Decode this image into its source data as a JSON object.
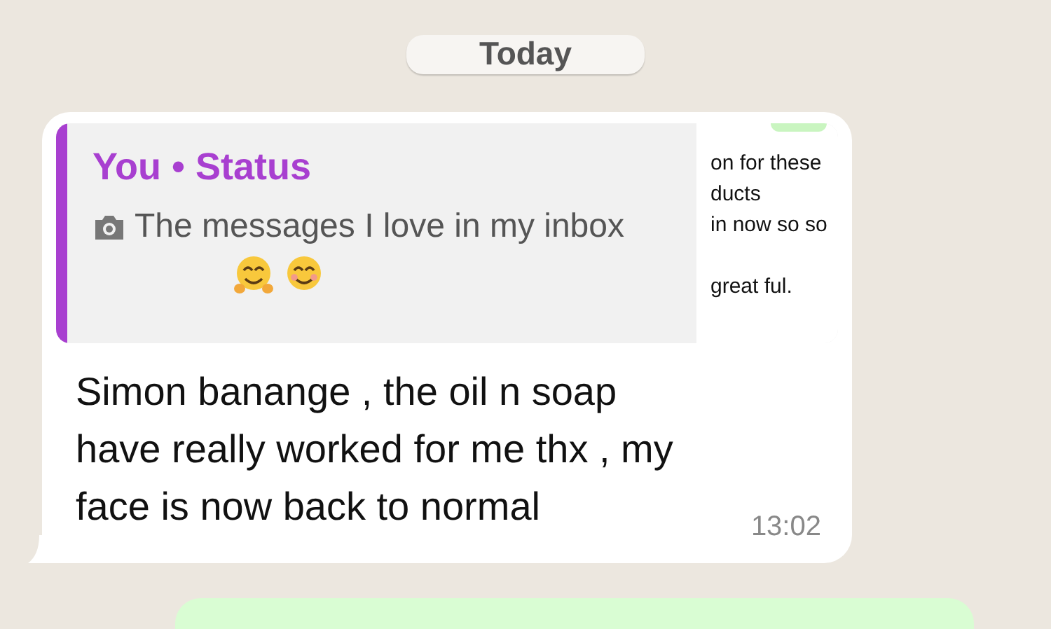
{
  "date_divider": {
    "label": "Today"
  },
  "message": {
    "quote": {
      "author": "You • Status",
      "text": "The messages I love in my inbox",
      "thumbnail_lines": [
        "on for these",
        "ducts",
        "in now so so",
        "great ful."
      ]
    },
    "text": "Simon banange , the oil n soap have really worked for me thx , my face is now back to normal",
    "time": "13:02"
  }
}
